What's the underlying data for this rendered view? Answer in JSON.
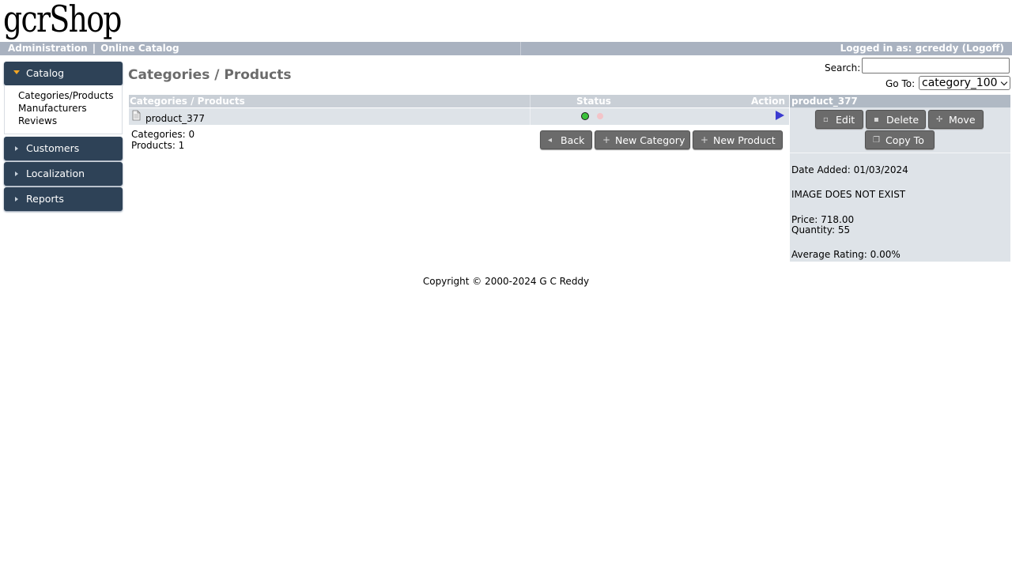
{
  "brand": {
    "logo": "gcrShop"
  },
  "topbar": {
    "links": [
      "Administration",
      "Online Catalog"
    ],
    "separator": "|",
    "logged_in": "Logged in as: gcreddy (Logoff)"
  },
  "sidebar": {
    "catalog": {
      "label": "Catalog",
      "links": [
        "Categories/Products",
        "Manufacturers",
        "Reviews"
      ]
    },
    "sections": [
      "Customers",
      "Localization",
      "Reports"
    ]
  },
  "main": {
    "title": "Categories / Products",
    "search_label": "Search:",
    "search_value": "",
    "goto_label": "Go To:",
    "goto_selected": "category_100"
  },
  "table": {
    "headers": {
      "name": "Categories / Products",
      "status": "Status",
      "action": "Action"
    },
    "rows": [
      {
        "name": "product_377",
        "status": "active"
      }
    ],
    "counts": {
      "categories": "Categories: 0",
      "products": "Products: 1"
    }
  },
  "buttons": {
    "back": "Back",
    "new_category": "New Category",
    "new_product": "New Product"
  },
  "info": {
    "title": "product_377",
    "edit": "Edit",
    "delete": "Delete",
    "move": "Move",
    "copy_to": "Copy To",
    "date_added": "Date Added: 01/03/2024",
    "image": "IMAGE DOES NOT EXIST",
    "price": "Price: 718.00",
    "quantity": "Quantity: 55",
    "rating": "Average Rating: 0.00%"
  },
  "footer": {
    "copyright": "Copyright © 2000-2024 G C Reddy"
  },
  "colors": {
    "topbar": "#a9b2c0",
    "menu": "#2e4257",
    "button": "#6b6b6b",
    "accent": "#f5a623"
  }
}
